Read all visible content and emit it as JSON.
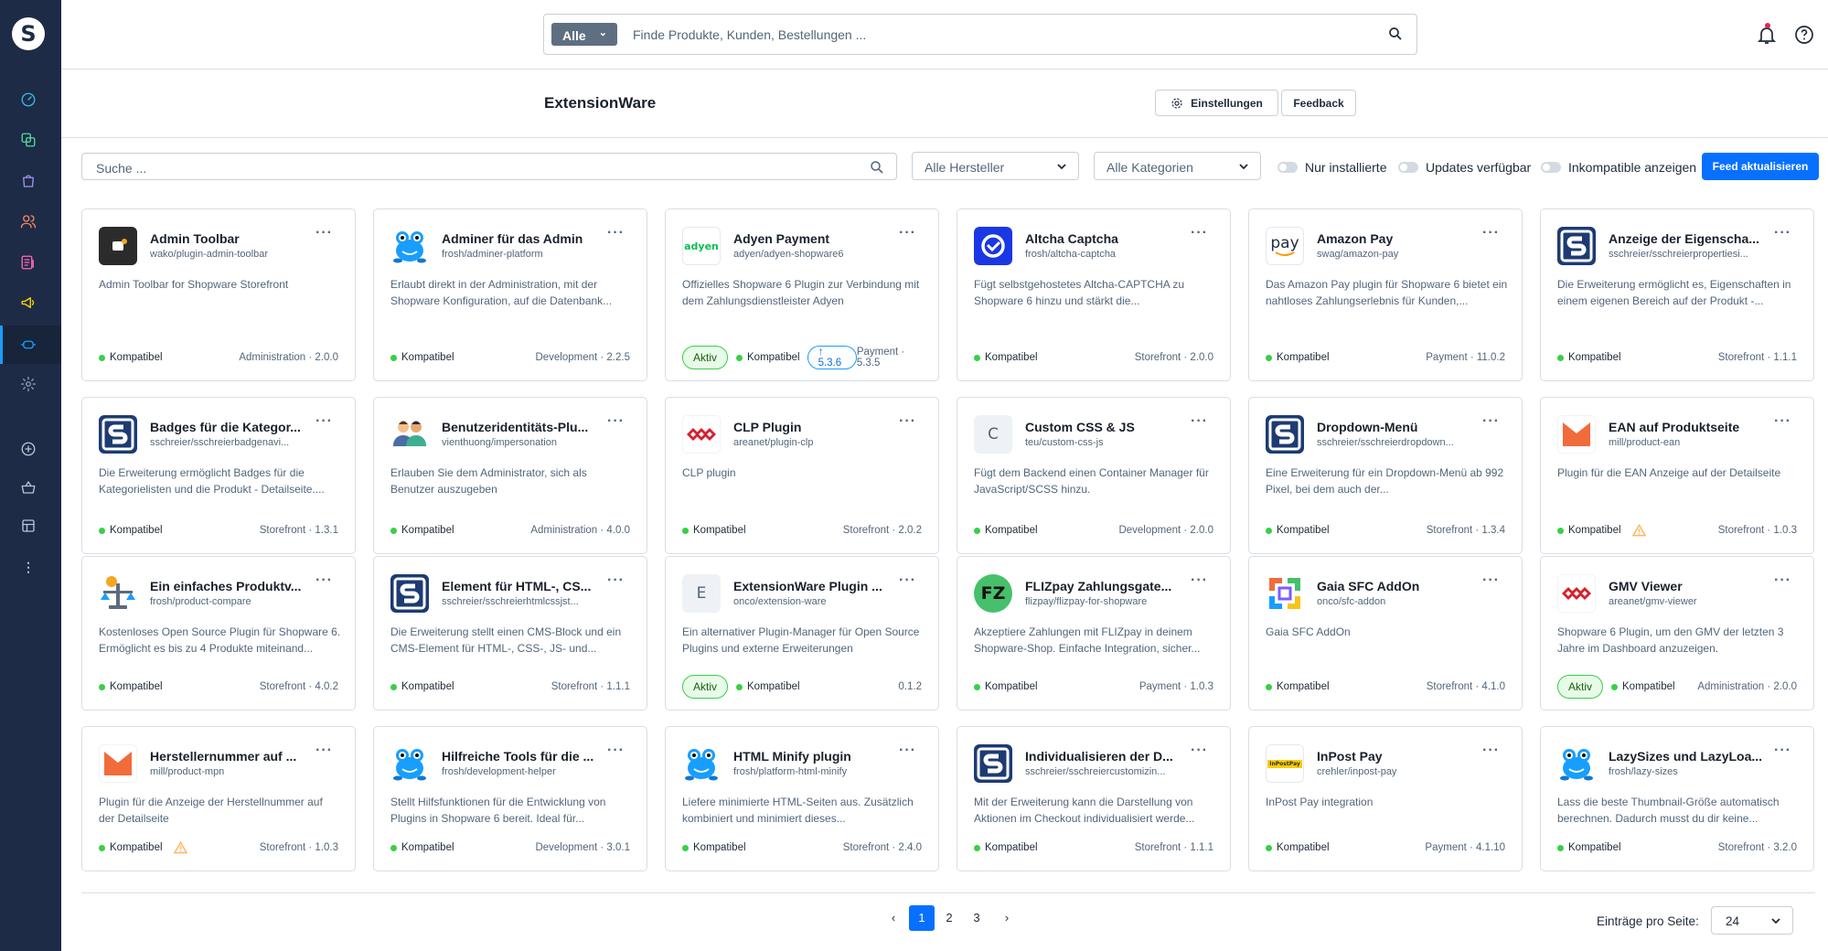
{
  "topbar": {
    "search_category": "Alle",
    "search_placeholder": "Finde Produkte, Kunden, Bestellungen ..."
  },
  "header": {
    "title": "ExtensionWare",
    "settings_label": "Einstellungen",
    "feedback_label": "Feedback"
  },
  "filters": {
    "search_placeholder": "Suche ...",
    "manufacturer": "Alle Hersteller",
    "category": "Alle Kategorien",
    "toggle_installed": "Nur installierte",
    "toggle_updates": "Updates verfügbar",
    "toggle_incompatible": "Inkompatible anzeigen",
    "refresh_label": "Feed aktualisieren"
  },
  "colors": {
    "sidebar": "#1d2b46",
    "accent": "#0870ff",
    "compatible": "#37d046",
    "warning": "#ffb75d"
  },
  "plugins": [
    {
      "title": "Admin Toolbar",
      "sub": "wako/plugin-admin-toolbar",
      "desc": "Admin Toolbar for Shopware Storefront",
      "status": "Kompatibel",
      "meta": "Administration · 2.0.0",
      "icon": "toolbar-icon"
    },
    {
      "title": "Adminer für das Admin",
      "sub": "frosh/adminer-platform",
      "desc": "Erlaubt direkt in der Administration, mit der Shopware Konfiguration, auf die Datenbank...",
      "status": "Kompatibel",
      "meta": "Development · 2.2.5",
      "icon": "frog-icon"
    },
    {
      "title": "Adyen Payment",
      "sub": "adyen/adyen-shopware6",
      "desc": "Offizielles Shopware 6 Plugin zur Verbindung mit dem Zahlungsdienstleister Adyen",
      "status": "Kompatibel",
      "active": "Aktiv",
      "update": "↑ 5.3.6",
      "meta": "Payment · 5.3.5",
      "icon": "adyen-icon",
      "icon_text": "adyen"
    },
    {
      "title": "Altcha Captcha",
      "sub": "frosh/altcha-captcha",
      "desc": "Fügt selbstgehostetes Altcha-CAPTCHA zu Shopware 6 hinzu und stärkt die...",
      "status": "Kompatibel",
      "meta": "Storefront · 2.0.0",
      "icon": "altcha-icon"
    },
    {
      "title": "Amazon Pay",
      "sub": "swag/amazon-pay",
      "desc": "Das Amazon Pay plugin für Shopware 6 bietet ein nahtloses Zahlungserlebnis für Kunden,...",
      "status": "Kompatibel",
      "meta": "Payment · 11.0.2",
      "icon": "amazon-pay-icon",
      "icon_text": "pay"
    },
    {
      "title": "Anzeige der Eigenscha...",
      "sub": "sschreier/sschreierpropertiesi...",
      "desc": "Die Erweiterung ermöglicht es, Eigenschaften in einem eigenen Bereich auf der Produkt -...",
      "status": "Kompatibel",
      "meta": "Storefront · 1.1.1",
      "icon": "s-logo-icon"
    },
    {
      "title": "Badges für die Kategor...",
      "sub": "sschreier/sschreierbadgenavi...",
      "desc": "Die Erweiterung ermöglicht Badges für die Kategorielisten und die Produkt - Detailseite....",
      "status": "Kompatibel",
      "meta": "Storefront · 1.3.1",
      "icon": "s-logo-icon"
    },
    {
      "title": "Benutzeridentitäts-Plu...",
      "sub": "vienthuong/impersonation",
      "desc": "Erlauben Sie dem Administrator, sich als Benutzer auszugeben",
      "status": "Kompatibel",
      "meta": "Administration · 4.0.0",
      "icon": "users-icon"
    },
    {
      "title": "CLP Plugin",
      "sub": "areanet/plugin-clp",
      "desc": "CLP plugin",
      "status": "Kompatibel",
      "meta": "Storefront · 2.0.2",
      "icon": "areanet-icon"
    },
    {
      "title": "Custom CSS & JS",
      "sub": "teu/custom-css-js",
      "desc": "Fügt dem Backend einen Container Manager für JavaScript/SCSS hinzu.",
      "status": "Kompatibel",
      "meta": "Development · 2.0.0",
      "icon": "letter-icon",
      "icon_text": "C"
    },
    {
      "title": "Dropdown-Menü",
      "sub": "sschreier/sschreierdropdown...",
      "desc": "Eine Erweiterung für ein Dropdown-Menü ab 992 Pixel, bei dem auch der...",
      "status": "Kompatibel",
      "meta": "Storefront · 1.3.4",
      "icon": "s-logo-icon"
    },
    {
      "title": "EAN auf Produktseite",
      "sub": "mill/product-ean",
      "desc": "Plugin für die EAN Anzeige auf der Detailseite",
      "status": "Kompatibel",
      "warn": true,
      "meta": "Storefront · 1.0.3",
      "icon": "mill-icon"
    },
    {
      "title": "Ein einfaches Produktv...",
      "sub": "frosh/product-compare",
      "desc": "Kostenloses Open Source Plugin für Shopware 6. Ermöglicht es bis zu 4 Produkte miteinand...",
      "status": "Kompatibel",
      "meta": "Storefront · 4.0.2",
      "icon": "compare-icon"
    },
    {
      "title": "Element für HTML-, CS...",
      "sub": "sschreier/sschreierhtmlcssjst...",
      "desc": "Die Erweiterung stellt einen CMS-Block und ein CMS-Element für HTML-, CSS-, JS- und...",
      "status": "Kompatibel",
      "meta": "Storefront · 1.1.1",
      "icon": "s-logo-icon"
    },
    {
      "title": "ExtensionWare Plugin ...",
      "sub": "onco/extension-ware",
      "desc": "Ein alternativer Plugin-Manager für Open Source Plugins und externe Erweiterungen",
      "status": "Kompatibel",
      "active": "Aktiv",
      "meta": "0.1.2",
      "icon": "letter-icon",
      "icon_text": "E"
    },
    {
      "title": "FLIZpay Zahlungsgate...",
      "sub": "flizpay/flizpay-for-shopware",
      "desc": "Akzeptiere Zahlungen mit FLIZpay in deinem Shopware-Shop. Einfache Integration, sicher...",
      "status": "Kompatibel",
      "meta": "Payment · 1.0.3",
      "icon": "fliz-icon",
      "icon_text": "FZ"
    },
    {
      "title": "Gaia SFC AddOn",
      "sub": "onco/sfc-addon",
      "desc": "Gaia SFC AddOn",
      "status": "Kompatibel",
      "meta": "Storefront · 4.1.0",
      "icon": "gaia-icon"
    },
    {
      "title": "GMV Viewer",
      "sub": "areanet/gmv-viewer",
      "desc": "Shopware 6 Plugin, um den GMV der letzten 3 Jahre im Dashboard anzuzeigen.",
      "status": "Kompatibel",
      "active": "Aktiv",
      "meta": "Administration · 2.0.0",
      "icon": "areanet-icon"
    },
    {
      "title": "Herstellernummer auf ...",
      "sub": "mill/product-mpn",
      "desc": "Plugin für die Anzeige der Herstellnummer auf der Detailseite",
      "status": "Kompatibel",
      "warn": true,
      "meta": "Storefront · 1.0.3",
      "icon": "mill-icon"
    },
    {
      "title": "Hilfreiche Tools für die ...",
      "sub": "frosh/development-helper",
      "desc": "Stellt Hilfsfunktionen für die Entwicklung von Plugins in Shopware 6 bereit. Ideal für...",
      "status": "Kompatibel",
      "meta": "Development · 3.0.1",
      "icon": "frog-icon"
    },
    {
      "title": "HTML Minify plugin",
      "sub": "frosh/platform-html-minify",
      "desc": "Liefere minimierte HTML-Seiten aus. Zusätzlich kombiniert und minimiert dieses...",
      "status": "Kompatibel",
      "meta": "Storefront · 2.4.0",
      "icon": "frog-icon"
    },
    {
      "title": "Individualisieren der D...",
      "sub": "sschreier/sschreiercustomizin...",
      "desc": "Mit der Erweiterung kann die Darstellung von Aktionen im Checkout individualisiert werde...",
      "status": "Kompatibel",
      "meta": "Storefront · 1.1.1",
      "icon": "s-logo-icon"
    },
    {
      "title": "InPost Pay",
      "sub": "crehler/inpost-pay",
      "desc": "InPost Pay integration",
      "status": "Kompatibel",
      "meta": "Payment · 4.1.10",
      "icon": "inpost-icon",
      "icon_text": "InPostPay"
    },
    {
      "title": "LazySizes und LazyLoa...",
      "sub": "frosh/lazy-sizes",
      "desc": "Lass die beste Thumbnail-Größe automatisch berechnen. Dadurch musst du dir keine...",
      "status": "Kompatibel",
      "meta": "Storefront · 3.2.0",
      "icon": "frog-icon"
    }
  ],
  "pagination": {
    "pages": [
      "1",
      "2",
      "3"
    ],
    "current": "1",
    "prev": "‹",
    "next": "›",
    "per_page_label": "Einträge pro Seite:",
    "per_page_value": "24"
  }
}
